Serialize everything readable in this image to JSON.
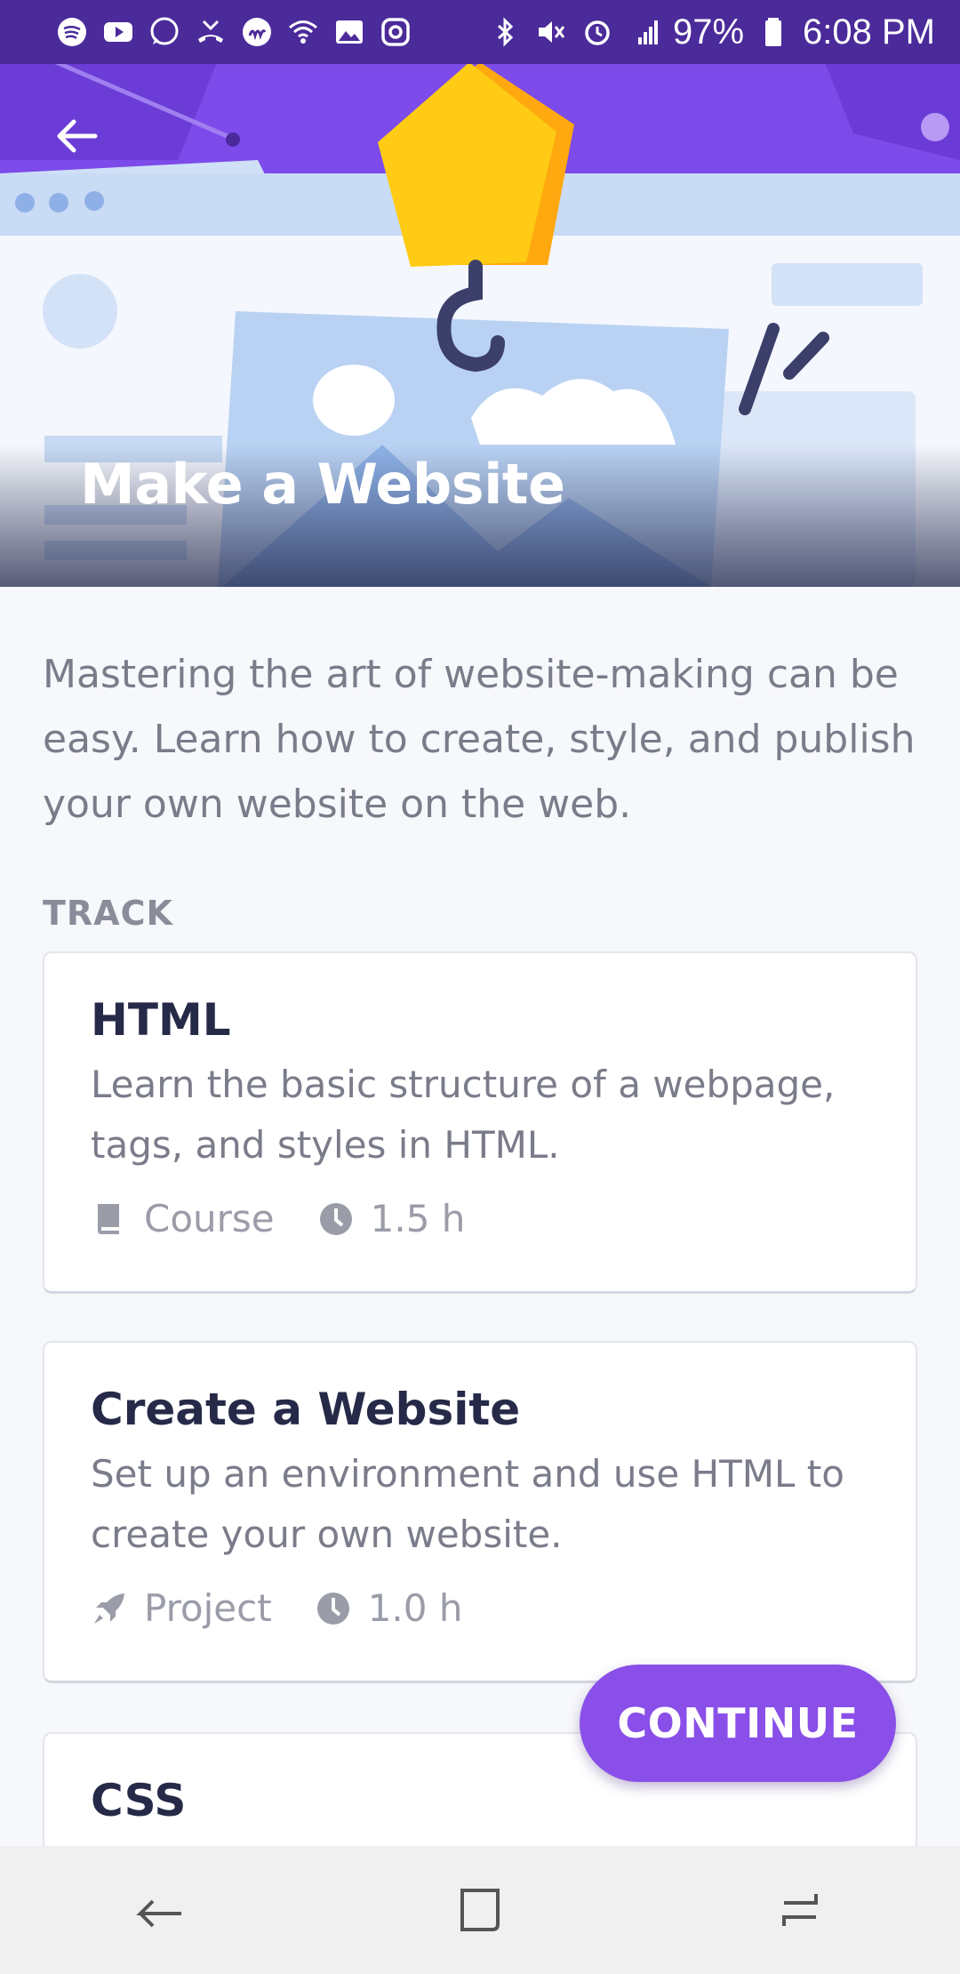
{
  "status_bar": {
    "battery": "97%",
    "time": "6:08 PM",
    "left_icons": [
      "spotify-icon",
      "youtube-icon",
      "whatsapp-icon",
      "missed-call-icon",
      "app-icon",
      "wifi-icon",
      "gallery-icon",
      "instagram-icon"
    ],
    "right_icons": [
      "bluetooth-icon",
      "mute-icon",
      "alarm-icon",
      "lte-signal-icon",
      "battery-icon"
    ]
  },
  "hero": {
    "title": "Make a Website",
    "accent_color": "#7a48e8"
  },
  "description": "Mastering the art of website-making can be easy. Learn how to create, style, and publish your own website on the web.",
  "track": {
    "label": "TRACK",
    "items": [
      {
        "title": "HTML",
        "description": "Learn the basic structure of a webpage, tags, and styles in HTML.",
        "type": "Course",
        "type_icon": "book-icon",
        "duration": "1.5 h"
      },
      {
        "title": "Create a Website",
        "description": "Set up an environment and use HTML to create your own website.",
        "type": "Project",
        "type_icon": "rocket-icon",
        "duration": "1.0 h"
      },
      {
        "title": "CSS"
      }
    ]
  },
  "continue_button": {
    "label": "CONTINUE",
    "color": "#8a4fe8"
  },
  "nav_bar": {
    "icons": [
      "back-nav-icon",
      "home-nav-icon",
      "recents-nav-icon"
    ]
  }
}
